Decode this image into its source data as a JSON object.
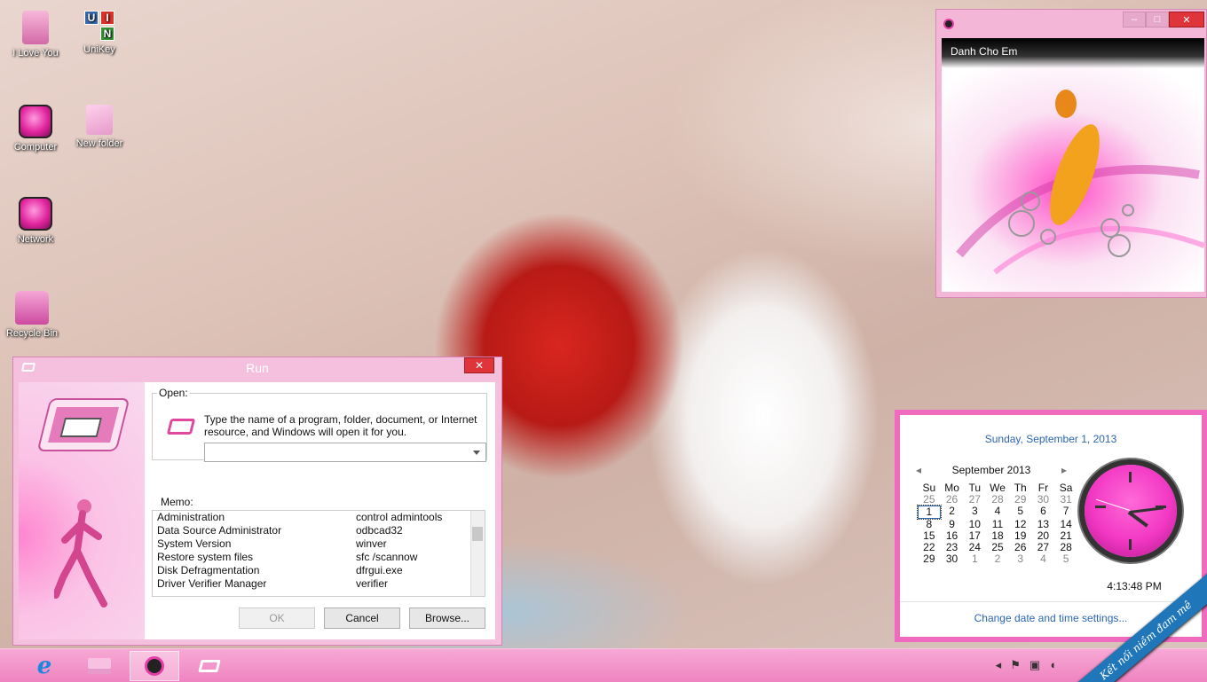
{
  "desktop": {
    "icons": [
      {
        "label": "I Love You"
      },
      {
        "label": "UniKey"
      },
      {
        "label": "Computer"
      },
      {
        "label": "New folder"
      },
      {
        "label": "Network"
      },
      {
        "label": "Recycle Bin"
      }
    ],
    "unikey_letters": [
      "U",
      "I",
      "",
      "N"
    ]
  },
  "run_dialog": {
    "title": "Run",
    "close_glyph": "✕",
    "open_label": "Open:",
    "description": "Type the name of a program, folder, document, or Internet resource, and Windows will open it for you.",
    "open_value": "",
    "memo_label": "Memo:",
    "memo_rows": [
      {
        "name": "Administration",
        "command": "control admintools"
      },
      {
        "name": "Data Source Administrator",
        "command": "odbcad32"
      },
      {
        "name": "System Version",
        "command": "winver"
      },
      {
        "name": "Restore system files",
        "command": "sfc /scannow"
      },
      {
        "name": "Disk Defragmentation",
        "command": "dfrgui.exe"
      },
      {
        "name": "Driver Verifier Manager",
        "command": "verifier"
      }
    ],
    "ok_label": "OK",
    "cancel_label": "Cancel",
    "browse_label": "Browse..."
  },
  "player": {
    "track_title": "Danh Cho Em",
    "min_glyph": "–",
    "max_glyph": "□",
    "close_glyph": "✕"
  },
  "calendar": {
    "full_date": "Sunday, September 1, 2013",
    "month_label": "September 2013",
    "prev_glyph": "◂",
    "next_glyph": "▸",
    "weekdays": [
      "Su",
      "Mo",
      "Tu",
      "We",
      "Th",
      "Fr",
      "Sa"
    ],
    "weeks": [
      [
        "25",
        "26",
        "27",
        "28",
        "29",
        "30",
        "31"
      ],
      [
        "1",
        "2",
        "3",
        "4",
        "5",
        "6",
        "7"
      ],
      [
        "8",
        "9",
        "10",
        "11",
        "12",
        "13",
        "14"
      ],
      [
        "15",
        "16",
        "17",
        "18",
        "19",
        "20",
        "21"
      ],
      [
        "22",
        "23",
        "24",
        "25",
        "26",
        "27",
        "28"
      ],
      [
        "29",
        "30",
        "1",
        "2",
        "3",
        "4",
        "5"
      ]
    ],
    "time": "4:13:48 PM",
    "settings_link": "Change date and time settings..."
  },
  "taskbar": {
    "ie_glyph": "e",
    "tray_glyphs": [
      "◂",
      "⚑",
      "▣",
      "◖"
    ]
  },
  "watermark": {
    "text": "Kết nối niềm đam mê"
  },
  "colors": {
    "accent_pink": "#f06ac0",
    "link_blue": "#2b66b1",
    "close_red": "#e0343b"
  }
}
